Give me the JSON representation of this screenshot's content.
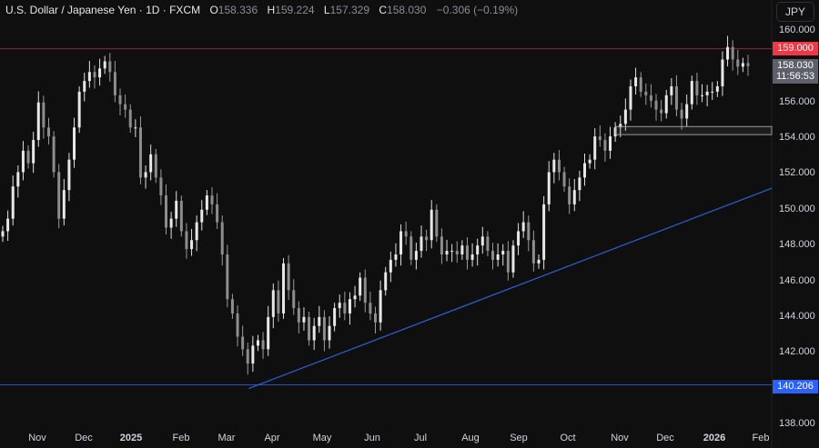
{
  "header": {
    "symbol": "U.S. Dollar / Japanese Yen · 1D · FXCM",
    "open_label": "O",
    "open": "158.336",
    "high_label": "H",
    "high": "159.224",
    "low_label": "L",
    "low": "157.329",
    "close_label": "C",
    "close": "158.030",
    "change": "−0.306 (−0.19%)"
  },
  "currency_button": "JPY",
  "price_tags": {
    "resistance": "159.000",
    "last_price": "158.030",
    "countdown": "11:56:53",
    "support": "140.206"
  },
  "colors": {
    "background": "#0f0f0f",
    "candle": "#d9d9d9",
    "resistance": "#f23645",
    "support": "#2962ff",
    "trendline": "#2f5fd6",
    "last_tag": "#5d606b"
  },
  "chart_data": {
    "type": "candlestick",
    "title": "U.S. Dollar / Japanese Yen · 1D · FXCM",
    "ylim": [
      138,
      160
    ],
    "y_ticks": [
      "160.000",
      "158.000",
      "156.000",
      "154.000",
      "152.000",
      "150.000",
      "148.000",
      "146.000",
      "144.000",
      "142.000",
      "140.000",
      "138.000"
    ],
    "x_ticks": [
      {
        "label": "Nov",
        "bold": false
      },
      {
        "label": "Dec",
        "bold": false
      },
      {
        "label": "2025",
        "bold": true
      },
      {
        "label": "Feb",
        "bold": false
      },
      {
        "label": "Mar",
        "bold": false
      },
      {
        "label": "Apr",
        "bold": false
      },
      {
        "label": "May",
        "bold": false
      },
      {
        "label": "Jun",
        "bold": false
      },
      {
        "label": "Jul",
        "bold": false
      },
      {
        "label": "Aug",
        "bold": false
      },
      {
        "label": "Sep",
        "bold": false
      },
      {
        "label": "Oct",
        "bold": false
      },
      {
        "label": "Nov",
        "bold": false
      },
      {
        "label": "Dec",
        "bold": false
      },
      {
        "label": "2026",
        "bold": true
      },
      {
        "label": "Feb",
        "bold": false
      }
    ],
    "closes": [
      148.8,
      149.5,
      151.3,
      152.1,
      153.3,
      152.6,
      153.9,
      156.0,
      154.6,
      154.1,
      152.1,
      149.5,
      151.1,
      152.8,
      154.6,
      156.6,
      157.2,
      157.7,
      157.4,
      157.9,
      158.3,
      157.7,
      156.4,
      155.9,
      155.6,
      154.6,
      154.6,
      151.8,
      152.1,
      153.1,
      151.8,
      150.8,
      149.0,
      149.5,
      150.5,
      148.8,
      147.8,
      148.3,
      149.3,
      150.0,
      150.8,
      150.3,
      149.3,
      147.5,
      145.0,
      144.2,
      142.9,
      142.2,
      141.4,
      142.4,
      142.7,
      142.2,
      144.0,
      145.5,
      144.2,
      147.0,
      145.5,
      144.5,
      143.7,
      144.0,
      142.7,
      143.5,
      144.0,
      142.7,
      143.5,
      144.5,
      144.8,
      144.2,
      145.0,
      145.2,
      146.2,
      144.8,
      144.2,
      143.7,
      145.5,
      146.5,
      147.2,
      147.5,
      148.8,
      148.5,
      147.2,
      147.7,
      148.5,
      148.3,
      150.0,
      148.5,
      147.5,
      147.7,
      147.7,
      147.5,
      148.0,
      147.2,
      147.5,
      148.0,
      148.5,
      147.7,
      147.2,
      147.5,
      147.7,
      146.5,
      148.0,
      148.8,
      149.3,
      148.3,
      147.0,
      147.2,
      150.3,
      152.1,
      152.8,
      152.1,
      151.3,
      150.3,
      151.1,
      151.8,
      152.6,
      152.8,
      154.1,
      153.9,
      153.3,
      154.1,
      154.6,
      154.8,
      155.6,
      156.9,
      157.4,
      156.6,
      156.4,
      156.1,
      155.6,
      155.4,
      156.4,
      156.9,
      155.6,
      155.1,
      155.9,
      157.2,
      156.4,
      156.4,
      156.6,
      156.6,
      156.9,
      158.4,
      159.1,
      158.4,
      158.0,
      158.2,
      158.03
    ],
    "horizontal_lines": [
      {
        "name": "resistance",
        "price": 159.0
      },
      {
        "name": "support",
        "price": 140.206
      }
    ],
    "trendline": {
      "start_price": 140.0,
      "end_price": 151.2
    },
    "zone": {
      "low": 154.2,
      "high": 154.65
    }
  }
}
